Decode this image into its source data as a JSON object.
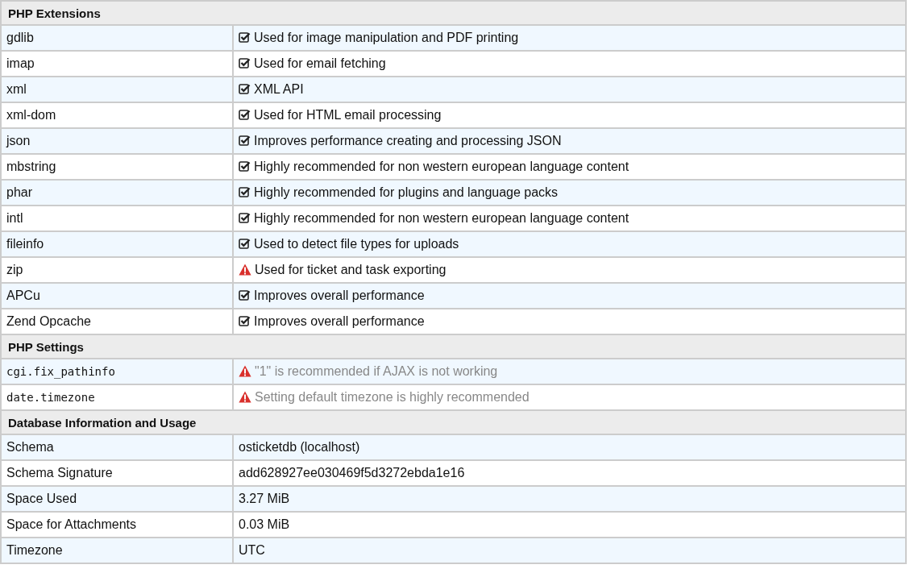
{
  "sections": [
    {
      "title": "PHP Extensions",
      "kind": "extensions",
      "rows": [
        {
          "name": "gdlib",
          "kind": "ok",
          "text": "Used for image manipulation and PDF printing"
        },
        {
          "name": "imap",
          "kind": "ok",
          "text": "Used for email fetching"
        },
        {
          "name": "xml",
          "kind": "ok",
          "text": "XML API"
        },
        {
          "name": "xml-dom",
          "kind": "ok",
          "text": "Used for HTML email processing"
        },
        {
          "name": "json",
          "kind": "ok",
          "text": "Improves performance creating and processing JSON"
        },
        {
          "name": "mbstring",
          "kind": "ok",
          "text": "Highly recommended for non western european language content"
        },
        {
          "name": "phar",
          "kind": "ok",
          "text": "Highly recommended for plugins and language packs"
        },
        {
          "name": "intl",
          "kind": "ok",
          "text": "Highly recommended for non western european language content"
        },
        {
          "name": "fileinfo",
          "kind": "ok",
          "text": "Used to detect file types for uploads"
        },
        {
          "name": "zip",
          "kind": "warning",
          "text": "Used for ticket and task exporting"
        },
        {
          "name": "APCu",
          "kind": "ok",
          "text": "Improves overall performance"
        },
        {
          "name": "Zend Opcache",
          "kind": "ok",
          "text": "Improves overall performance"
        }
      ]
    },
    {
      "title": "PHP Settings",
      "kind": "settings",
      "rows": [
        {
          "name": "cgi.fix_pathinfo",
          "kind": "warning",
          "text": "\"1\" is recommended if AJAX is not working"
        },
        {
          "name": "date.timezone",
          "kind": "warning",
          "text": "Setting default timezone is highly recommended"
        }
      ]
    },
    {
      "title": "Database Information and Usage",
      "kind": "info",
      "rows": [
        {
          "name": "Schema",
          "text": "osticketdb (localhost)"
        },
        {
          "name": "Schema Signature",
          "text": "add628927ee030469f5d3272ebda1e16"
        },
        {
          "name": "Space Used",
          "text": "3.27 MiB"
        },
        {
          "name": "Space for Attachments",
          "text": "0.03 MiB"
        },
        {
          "name": "Timezone",
          "text": "UTC"
        }
      ]
    }
  ]
}
